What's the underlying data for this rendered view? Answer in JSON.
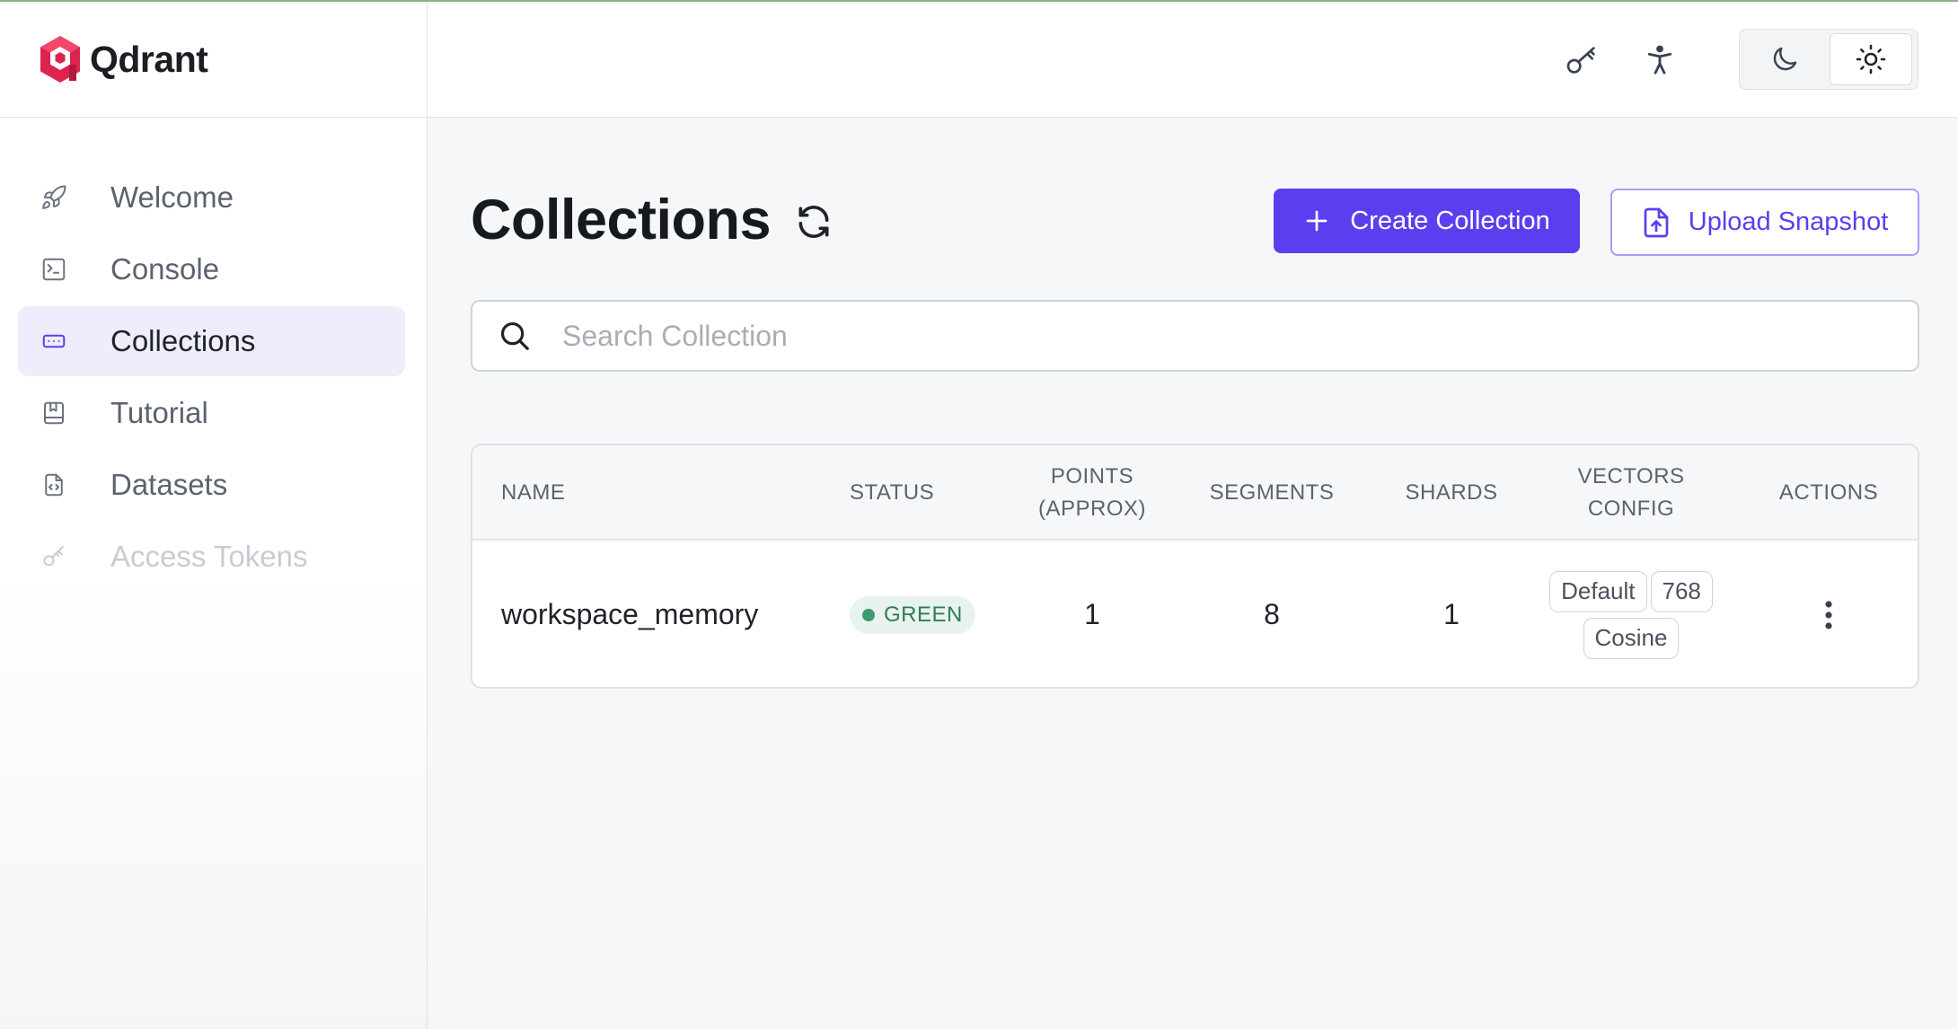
{
  "brand": {
    "name": "Qdrant",
    "accent": "#dc244c"
  },
  "sidebar": {
    "items": [
      {
        "label": "Welcome",
        "icon": "rocket-icon"
      },
      {
        "label": "Console",
        "icon": "terminal-icon"
      },
      {
        "label": "Collections",
        "icon": "collection-icon",
        "active": true
      },
      {
        "label": "Tutorial",
        "icon": "book-icon"
      },
      {
        "label": "Datasets",
        "icon": "file-code-icon"
      },
      {
        "label": "Access Tokens",
        "icon": "key-icon",
        "disabled": true
      }
    ]
  },
  "topbar": {
    "icons": [
      "key-icon",
      "accessibility-icon"
    ],
    "theme": {
      "options": [
        "dark",
        "light"
      ],
      "selected": "light"
    }
  },
  "page": {
    "title": "Collections",
    "create_label": "Create Collection",
    "upload_label": "Upload Snapshot",
    "accent": "#5a3ff0"
  },
  "search": {
    "placeholder": "Search Collection",
    "value": ""
  },
  "table": {
    "headers": {
      "name": "NAME",
      "status": "STATUS",
      "points_1": "POINTS",
      "points_2": "(APPROX)",
      "segments": "SEGMENTS",
      "shards": "SHARDS",
      "vectors_1": "VECTORS",
      "vectors_2": "CONFIG",
      "actions": "ACTIONS"
    },
    "rows": [
      {
        "name": "workspace_memory",
        "status": "GREEN",
        "status_color": "#3c9a6f",
        "points": "1",
        "segments": "8",
        "shards": "1",
        "vectors": {
          "name": "Default",
          "size": "768",
          "distance": "Cosine"
        }
      }
    ]
  }
}
